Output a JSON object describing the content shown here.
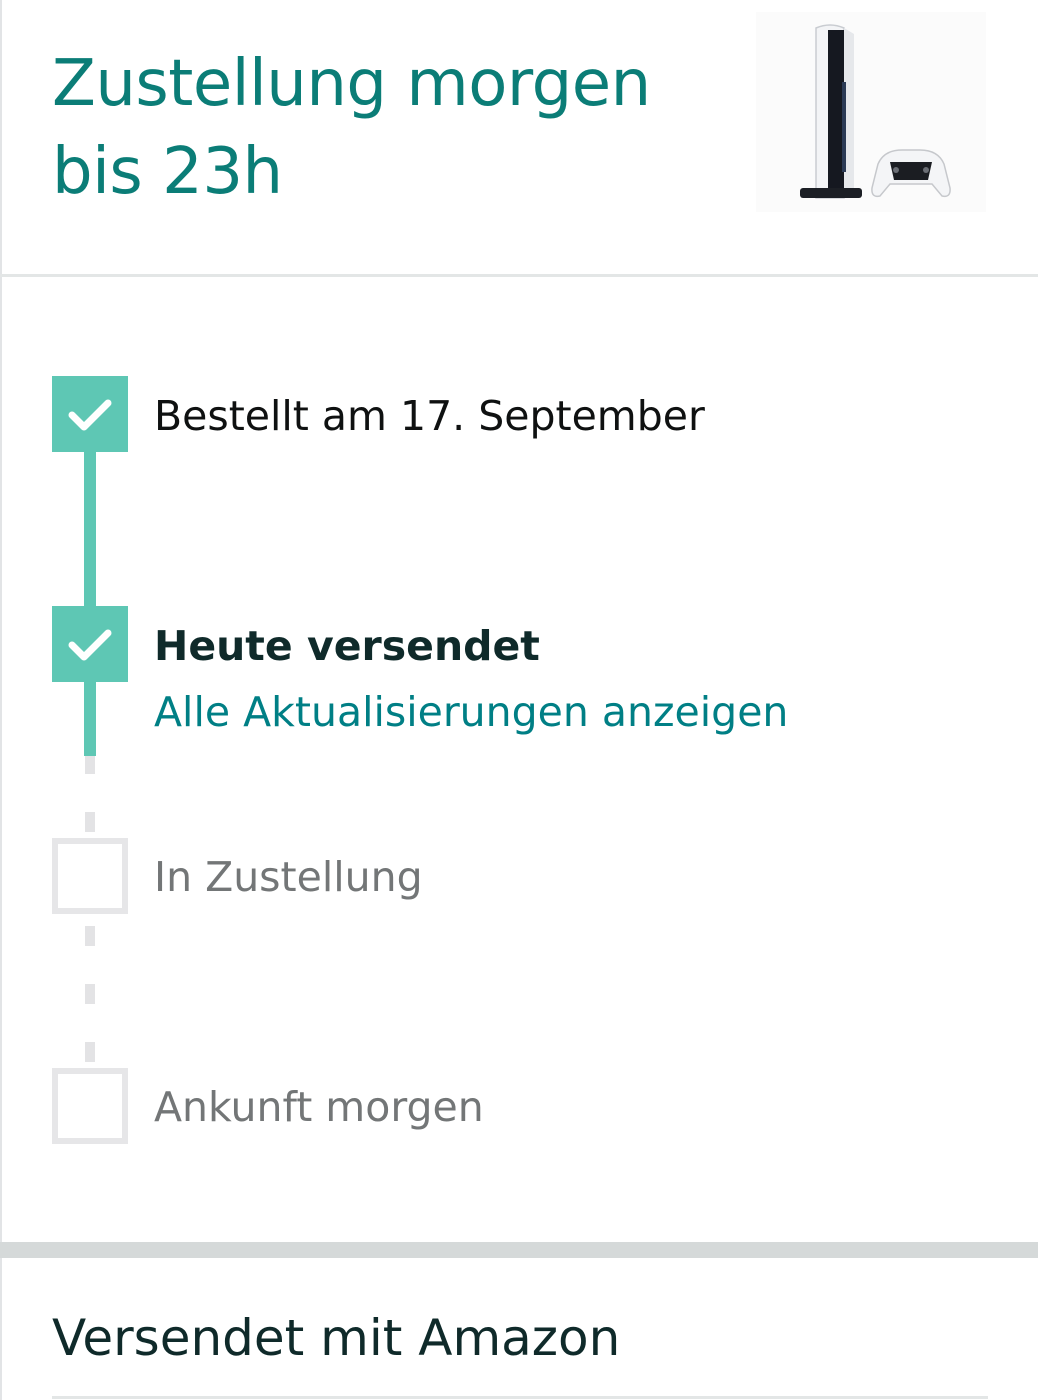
{
  "header": {
    "title_line1": "Zustellung morgen",
    "title_line2": "bis 23h",
    "product_image_icon": "game-console-with-controller"
  },
  "timeline": {
    "steps": [
      {
        "label": "Bestellt am 17. September",
        "status": "done"
      },
      {
        "label": "Heute versendet",
        "status": "done",
        "link": "Alle Aktualisierungen anzeigen"
      },
      {
        "label": "In Zustellung",
        "status": "pending"
      },
      {
        "label": "Ankunft morgen",
        "status": "pending"
      }
    ],
    "done_icon": "check-icon"
  },
  "shipping": {
    "title": "Versendet mit Amazon"
  },
  "colors": {
    "accent_teal": "#0b7d77",
    "timeline_done": "#5ec7b4",
    "link": "#007f85",
    "pending_border": "#e6e6e8"
  }
}
